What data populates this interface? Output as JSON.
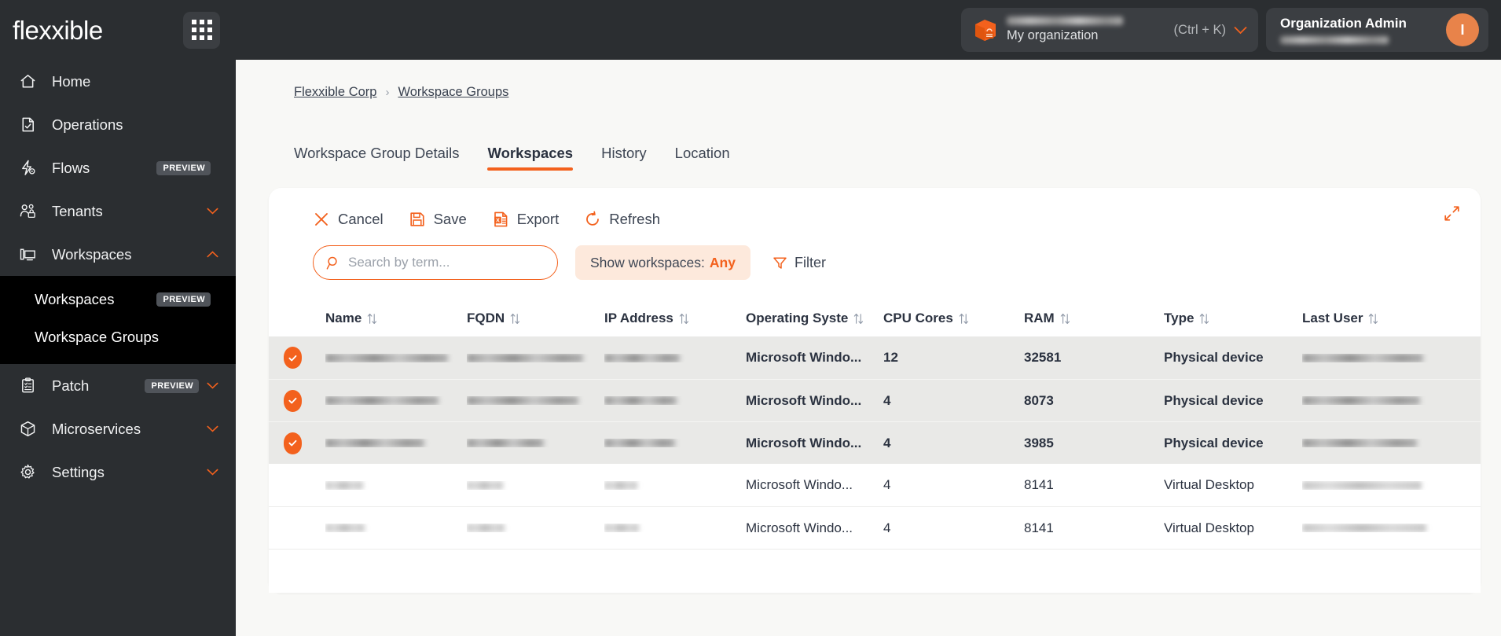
{
  "topbar": {
    "logo_text": "flexxible",
    "apps_icon": "apps-grid-icon",
    "org": {
      "icon": "package-box-icon",
      "name_redacted": "",
      "subtitle": "My organization",
      "shortcut": "(Ctrl + K)",
      "chevron_icon": "chevron-down-icon"
    },
    "user": {
      "role": "Organization Admin",
      "name_redacted": "",
      "avatar_initial": "I"
    }
  },
  "sidebar": {
    "items": [
      {
        "label": "Home",
        "icon": "home-icon",
        "badge": "",
        "chevron": ""
      },
      {
        "label": "Operations",
        "icon": "document-check-icon",
        "badge": "",
        "chevron": ""
      },
      {
        "label": "Flows",
        "icon": "flow-bolt-icon",
        "badge": "PREVIEW",
        "chevron": ""
      },
      {
        "label": "Tenants",
        "icon": "users-lock-icon",
        "badge": "",
        "chevron": "chevron-down-icon"
      },
      {
        "label": "Workspaces",
        "icon": "workspace-monitor-icon",
        "badge": "",
        "chevron": "chevron-up-icon"
      }
    ],
    "submenu": [
      {
        "label": "Workspaces",
        "badge": "PREVIEW"
      },
      {
        "label": "Workspace Groups",
        "badge": ""
      }
    ],
    "items_lower": [
      {
        "label": "Patch",
        "icon": "clipboard-list-icon",
        "badge": "PREVIEW",
        "chevron": "chevron-down-icon"
      },
      {
        "label": "Microservices",
        "icon": "cube-icon",
        "badge": "",
        "chevron": "chevron-down-icon"
      },
      {
        "label": "Settings",
        "icon": "gear-icon",
        "badge": "",
        "chevron": "chevron-down-icon"
      }
    ]
  },
  "breadcrumb": {
    "items": [
      "Flexxible Corp",
      "Workspace Groups"
    ],
    "separator": "›"
  },
  "tabs": [
    {
      "label": "Workspace Group Details",
      "active": false
    },
    {
      "label": "Workspaces",
      "active": true
    },
    {
      "label": "History",
      "active": false
    },
    {
      "label": "Location",
      "active": false
    }
  ],
  "toolbar": {
    "expand_icon": "expand-arrows-icon",
    "actions": [
      {
        "label": "Cancel",
        "icon": "close-x-icon"
      },
      {
        "label": "Save",
        "icon": "floppy-disk-icon"
      },
      {
        "label": "Export",
        "icon": "excel-file-icon"
      },
      {
        "label": "Refresh",
        "icon": "refresh-circular-icon"
      }
    ]
  },
  "filters": {
    "search_placeholder": "Search by term...",
    "search_value": "",
    "search_icon": "search-icon",
    "show_label": "Show workspaces:",
    "show_value": "Any",
    "filter_label": "Filter",
    "filter_icon": "funnel-icon"
  },
  "table": {
    "sort_icon": "sort-updown-icon",
    "columns": [
      "Name",
      "FQDN",
      "IP Address",
      "Operating Syste",
      "CPU Cores",
      "RAM",
      "Type",
      "Last User"
    ],
    "rows": [
      {
        "selected": true,
        "name": "",
        "fqdn": "",
        "ip": "",
        "os": "Microsoft Windo...",
        "cpu": "12",
        "ram": "32581",
        "type": "Physical device",
        "last_user": ""
      },
      {
        "selected": true,
        "name": "",
        "fqdn": "",
        "ip": "",
        "os": "Microsoft Windo...",
        "cpu": "4",
        "ram": "8073",
        "type": "Physical device",
        "last_user": ""
      },
      {
        "selected": true,
        "name": "",
        "fqdn": "",
        "ip": "",
        "os": "Microsoft Windo...",
        "cpu": "4",
        "ram": "3985",
        "type": "Physical device",
        "last_user": ""
      },
      {
        "selected": false,
        "name": "",
        "fqdn": "",
        "ip": "",
        "os": "Microsoft Windo...",
        "cpu": "4",
        "ram": "8141",
        "type": "Virtual Desktop",
        "last_user": ""
      },
      {
        "selected": false,
        "name": "",
        "fqdn": "",
        "ip": "",
        "os": "Microsoft Windo...",
        "cpu": "4",
        "ram": "8141",
        "type": "Virtual Desktop",
        "last_user": ""
      }
    ]
  },
  "colors": {
    "accent_orange": "#f3611d",
    "accent_soft": "#fde9dc",
    "sidebar_bg": "#2b2e31",
    "submenu_bg": "#000000",
    "page_bg": "#f8f8f6",
    "row_selected_bg": "#e9e9e7",
    "text_dark": "#2b3240"
  }
}
